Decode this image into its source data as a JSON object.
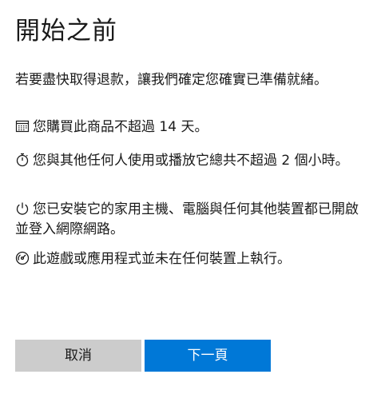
{
  "dialog": {
    "title": "開始之前",
    "intro": "若要盡快取得退款，讓我們確定您確實已準備就緒。",
    "conditions": [
      {
        "icon": "calendar-icon",
        "text": "您購買此商品不超過 14 天。"
      },
      {
        "icon": "stopwatch-icon",
        "text": "您與其他任何人使用或播放它總共不超過 2 個小時。"
      },
      {
        "icon": "power-icon",
        "text": "您已安裝它的家用主機、電腦與任何其他裝置都已開啟並登入網際網路。"
      },
      {
        "icon": "gauge-icon",
        "text": "此遊戲或應用程式並未在任何裝置上執行。"
      }
    ],
    "buttons": {
      "cancel_label": "取消",
      "next_label": "下一頁"
    }
  },
  "colors": {
    "accent": "#0078d7",
    "secondary_button": "#cccccc",
    "text": "#1a1a1a",
    "background": "#ffffff"
  }
}
